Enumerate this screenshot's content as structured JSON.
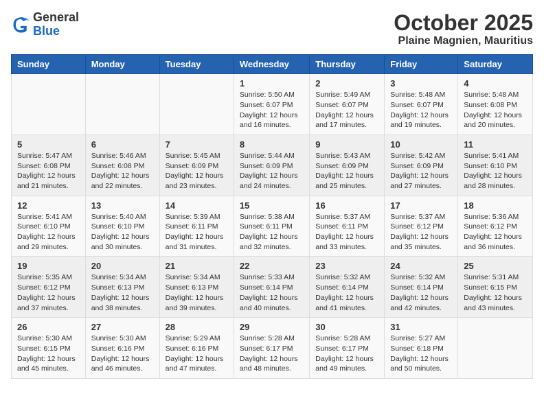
{
  "header": {
    "logo": {
      "general": "General",
      "blue": "Blue"
    },
    "title": "October 2025",
    "subtitle": "Plaine Magnien, Mauritius"
  },
  "weekdays": [
    "Sunday",
    "Monday",
    "Tuesday",
    "Wednesday",
    "Thursday",
    "Friday",
    "Saturday"
  ],
  "weeks": [
    [
      {
        "day": "",
        "info": ""
      },
      {
        "day": "",
        "info": ""
      },
      {
        "day": "",
        "info": ""
      },
      {
        "day": "1",
        "info": "Sunrise: 5:50 AM\nSunset: 6:07 PM\nDaylight: 12 hours and 16 minutes."
      },
      {
        "day": "2",
        "info": "Sunrise: 5:49 AM\nSunset: 6:07 PM\nDaylight: 12 hours and 17 minutes."
      },
      {
        "day": "3",
        "info": "Sunrise: 5:48 AM\nSunset: 6:07 PM\nDaylight: 12 hours and 19 minutes."
      },
      {
        "day": "4",
        "info": "Sunrise: 5:48 AM\nSunset: 6:08 PM\nDaylight: 12 hours and 20 minutes."
      }
    ],
    [
      {
        "day": "5",
        "info": "Sunrise: 5:47 AM\nSunset: 6:08 PM\nDaylight: 12 hours and 21 minutes."
      },
      {
        "day": "6",
        "info": "Sunrise: 5:46 AM\nSunset: 6:08 PM\nDaylight: 12 hours and 22 minutes."
      },
      {
        "day": "7",
        "info": "Sunrise: 5:45 AM\nSunset: 6:09 PM\nDaylight: 12 hours and 23 minutes."
      },
      {
        "day": "8",
        "info": "Sunrise: 5:44 AM\nSunset: 6:09 PM\nDaylight: 12 hours and 24 minutes."
      },
      {
        "day": "9",
        "info": "Sunrise: 5:43 AM\nSunset: 6:09 PM\nDaylight: 12 hours and 25 minutes."
      },
      {
        "day": "10",
        "info": "Sunrise: 5:42 AM\nSunset: 6:09 PM\nDaylight: 12 hours and 27 minutes."
      },
      {
        "day": "11",
        "info": "Sunrise: 5:41 AM\nSunset: 6:10 PM\nDaylight: 12 hours and 28 minutes."
      }
    ],
    [
      {
        "day": "12",
        "info": "Sunrise: 5:41 AM\nSunset: 6:10 PM\nDaylight: 12 hours and 29 minutes."
      },
      {
        "day": "13",
        "info": "Sunrise: 5:40 AM\nSunset: 6:10 PM\nDaylight: 12 hours and 30 minutes."
      },
      {
        "day": "14",
        "info": "Sunrise: 5:39 AM\nSunset: 6:11 PM\nDaylight: 12 hours and 31 minutes."
      },
      {
        "day": "15",
        "info": "Sunrise: 5:38 AM\nSunset: 6:11 PM\nDaylight: 12 hours and 32 minutes."
      },
      {
        "day": "16",
        "info": "Sunrise: 5:37 AM\nSunset: 6:11 PM\nDaylight: 12 hours and 33 minutes."
      },
      {
        "day": "17",
        "info": "Sunrise: 5:37 AM\nSunset: 6:12 PM\nDaylight: 12 hours and 35 minutes."
      },
      {
        "day": "18",
        "info": "Sunrise: 5:36 AM\nSunset: 6:12 PM\nDaylight: 12 hours and 36 minutes."
      }
    ],
    [
      {
        "day": "19",
        "info": "Sunrise: 5:35 AM\nSunset: 6:12 PM\nDaylight: 12 hours and 37 minutes."
      },
      {
        "day": "20",
        "info": "Sunrise: 5:34 AM\nSunset: 6:13 PM\nDaylight: 12 hours and 38 minutes."
      },
      {
        "day": "21",
        "info": "Sunrise: 5:34 AM\nSunset: 6:13 PM\nDaylight: 12 hours and 39 minutes."
      },
      {
        "day": "22",
        "info": "Sunrise: 5:33 AM\nSunset: 6:14 PM\nDaylight: 12 hours and 40 minutes."
      },
      {
        "day": "23",
        "info": "Sunrise: 5:32 AM\nSunset: 6:14 PM\nDaylight: 12 hours and 41 minutes."
      },
      {
        "day": "24",
        "info": "Sunrise: 5:32 AM\nSunset: 6:14 PM\nDaylight: 12 hours and 42 minutes."
      },
      {
        "day": "25",
        "info": "Sunrise: 5:31 AM\nSunset: 6:15 PM\nDaylight: 12 hours and 43 minutes."
      }
    ],
    [
      {
        "day": "26",
        "info": "Sunrise: 5:30 AM\nSunset: 6:15 PM\nDaylight: 12 hours and 45 minutes."
      },
      {
        "day": "27",
        "info": "Sunrise: 5:30 AM\nSunset: 6:16 PM\nDaylight: 12 hours and 46 minutes."
      },
      {
        "day": "28",
        "info": "Sunrise: 5:29 AM\nSunset: 6:16 PM\nDaylight: 12 hours and 47 minutes."
      },
      {
        "day": "29",
        "info": "Sunrise: 5:28 AM\nSunset: 6:17 PM\nDaylight: 12 hours and 48 minutes."
      },
      {
        "day": "30",
        "info": "Sunrise: 5:28 AM\nSunset: 6:17 PM\nDaylight: 12 hours and 49 minutes."
      },
      {
        "day": "31",
        "info": "Sunrise: 5:27 AM\nSunset: 6:18 PM\nDaylight: 12 hours and 50 minutes."
      },
      {
        "day": "",
        "info": ""
      }
    ]
  ]
}
